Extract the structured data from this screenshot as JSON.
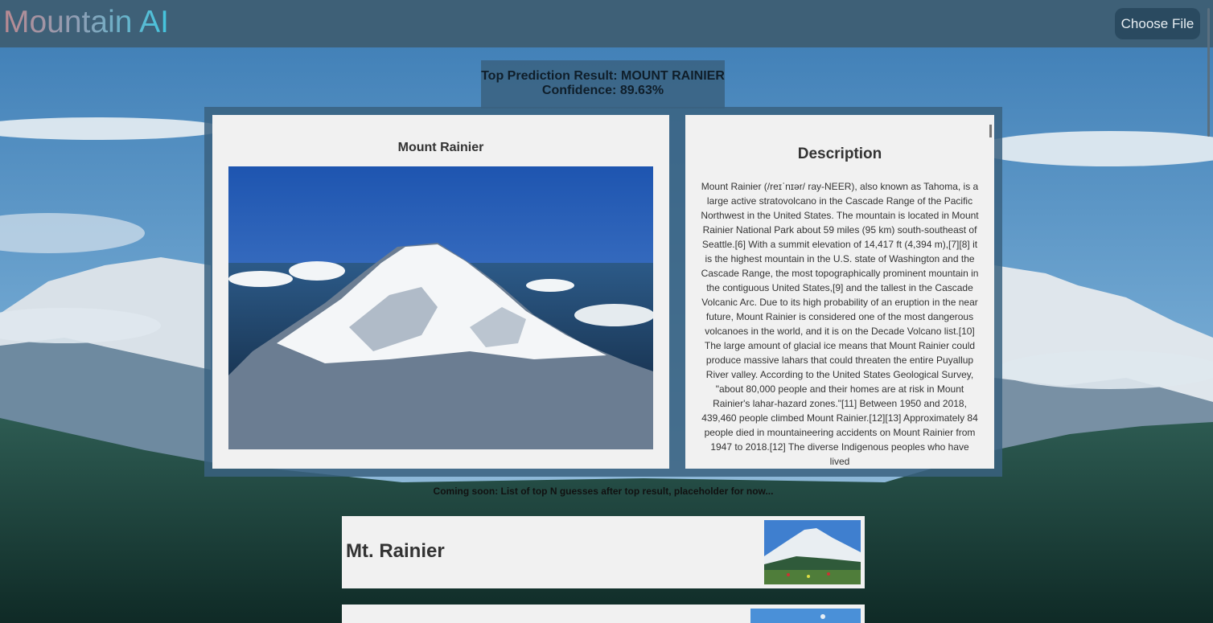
{
  "header": {
    "logo": "Mountain AI",
    "choose_file_label": "Choose File"
  },
  "prediction": {
    "top_result_label": "Top Prediction Result: MOUNT RAINIER",
    "confidence_label": "Confidence: 89.63%"
  },
  "result_card": {
    "title": "Mount Rainier"
  },
  "description": {
    "heading": "Description",
    "text": "Mount Rainier (/reɪˈnɪər/ ray-NEER), also known as Tahoma, is a large active stratovolcano in the Cascade Range of the Pacific Northwest in the United States. The mountain is located in Mount Rainier National Park about 59 miles (95 km) south-southeast of Seattle.[6] With a summit elevation of 14,417 ft (4,394 m),[7][8] it is the highest mountain in the U.S. state of Washington and the Cascade Range, the most topographically prominent mountain in the contiguous United States,[9] and the tallest in the Cascade Volcanic Arc. Due to its high probability of an eruption in the near future, Mount Rainier is considered one of the most dangerous volcanoes in the world, and it is on the Decade Volcano list.[10] The large amount of glacial ice means that Mount Rainier could produce massive lahars that could threaten the entire Puyallup River valley. According to the United States Geological Survey, \"about 80,000 people and their homes are at risk in Mount Rainier's lahar-hazard zones.\"[11] Between 1950 and 2018, 439,460 people climbed Mount Rainier.[12][13] Approximately 84 people died in mountaineering accidents on Mount Rainier from 1947 to 2018.[12] The diverse Indigenous peoples who have lived"
  },
  "coming_soon": "Coming soon: List of top N guesses after top result, placeholder for now...",
  "guesses": [
    {
      "name": "Mt. Rainier"
    },
    {
      "name": ""
    }
  ]
}
